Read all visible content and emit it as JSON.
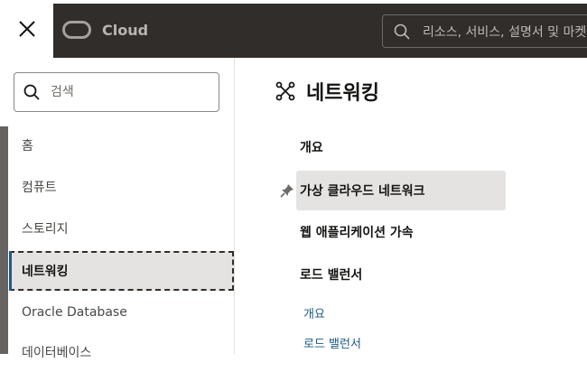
{
  "header": {
    "logo_text": "Cloud",
    "search_placeholder": "리소스, 서비스, 설명서 및 마켓플레이스 검색"
  },
  "nav": {
    "search_placeholder": "검색",
    "items": [
      {
        "label": "홈"
      },
      {
        "label": "컴퓨트"
      },
      {
        "label": "스토리지"
      },
      {
        "label": "네트워킹"
      },
      {
        "label": "Oracle Database"
      },
      {
        "label": "데이터베이스"
      }
    ],
    "active_index": 3
  },
  "section": {
    "title": "네트워킹",
    "items": [
      {
        "label": "개요"
      },
      {
        "label": "가상 클라우드 네트워크"
      },
      {
        "label": "웹 애플리케이션 가속"
      },
      {
        "label": "로드 밸런서"
      }
    ],
    "links": [
      {
        "label": "개요"
      },
      {
        "label": "로드 밸런서"
      }
    ]
  },
  "colors": {
    "topbar": "#312d2a",
    "active_bg": "#e4e3e1",
    "link": "#1e5a86"
  },
  "icons": [
    "close-icon",
    "oracle-logo-icon",
    "search-icon",
    "network-icon",
    "pin-icon"
  ]
}
